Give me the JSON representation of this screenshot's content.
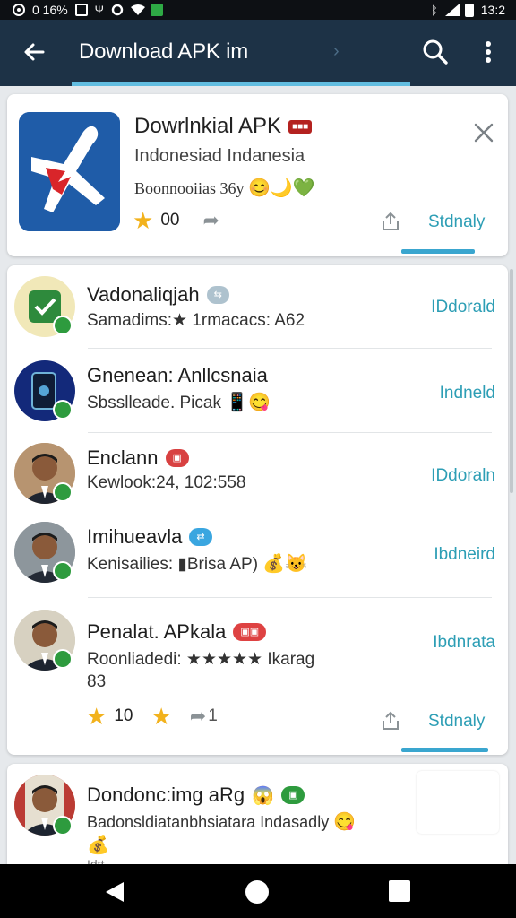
{
  "status_bar": {
    "left_text": "0 16%",
    "time": "13:2"
  },
  "app_bar": {
    "title": "Download APK im"
  },
  "featured": {
    "title": "Dowrlnkial APK",
    "subtitle": "Indonesiad Indanesia",
    "description": "Boonnooiias 36y",
    "rating_count": "00",
    "action_label": "Stdnaly"
  },
  "list": [
    {
      "title": "Vadonaliqjah",
      "subtitle": "Samadims:★ 1rmacacs: A62",
      "action": "IDdorald",
      "avatar": "app-check"
    },
    {
      "title": "Gnenean: Anllcsnaia",
      "subtitle": "Sbsslleade. Picak",
      "action": "Indneld",
      "avatar": "app-phone"
    },
    {
      "title": "Enclann",
      "subtitle": "Kewlook:24, 102:558",
      "action": "IDdoraln",
      "avatar": "person"
    },
    {
      "title": "Imihueavla",
      "subtitle": "Kenisailies: ▮Brisa AP)",
      "action": "Ibdneird",
      "avatar": "person"
    },
    {
      "title": "Penalat. APkala",
      "subtitle": "Roonliadedi: ★★★★★ Ikarag",
      "subtitle2": "83",
      "action": "Ibdnrata",
      "avatar": "person"
    }
  ],
  "list_footer": {
    "rating_count": "10",
    "share_count": "1",
    "action_label": "Stdnaly"
  },
  "bottom_item": {
    "title": "Dondonc:img aRg",
    "subtitle": "Badonsldiatanbhsiatara Indasadly",
    "subtitle2": "Idtt"
  },
  "colors": {
    "app_bar": "#1d3246",
    "accent": "#2d9eb5",
    "star": "#f2b21d",
    "verify": "#2e9b3e"
  }
}
